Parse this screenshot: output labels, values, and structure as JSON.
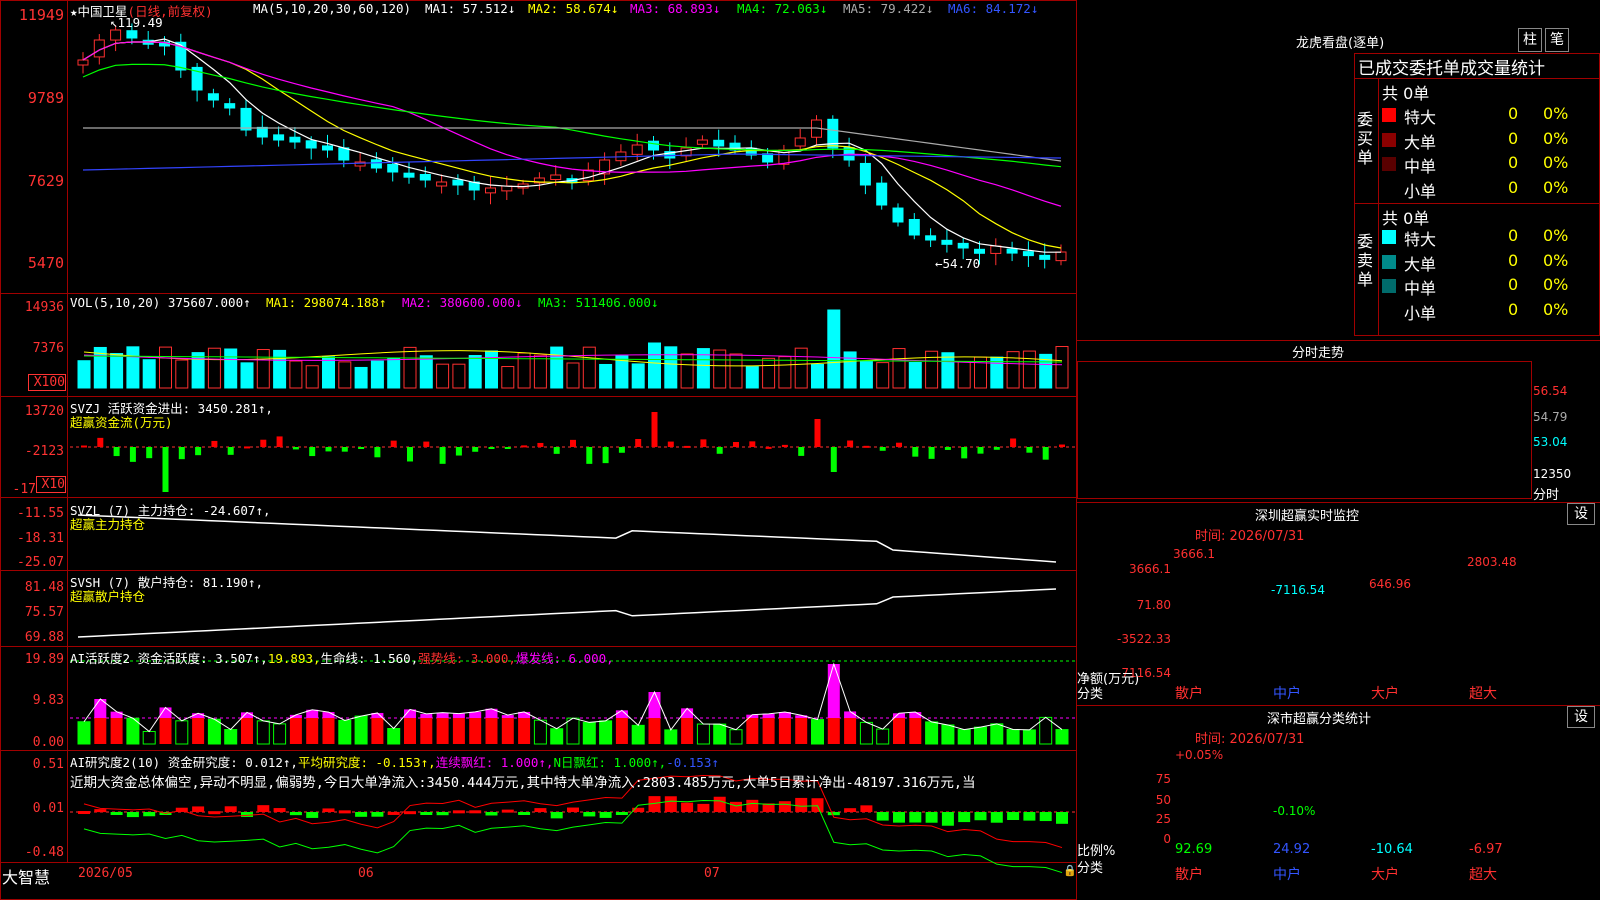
{
  "stock": {
    "name": "中国卫星",
    "period": "(日线,前复权)",
    "max_note": "119.49",
    "min_note": "←54.70"
  },
  "ma": {
    "params": "MA(5,10,20,30,60,120)",
    "ma1": "MA1: 57.512↓",
    "ma2": "MA2: 58.674↓",
    "ma3": "MA3: 68.893↓",
    "ma4": "MA4: 72.063↓",
    "ma5": "MA5: 79.422↓",
    "ma6": "MA6: 84.172↓"
  },
  "price_axis": [
    "11949",
    "9789",
    "7629",
    "5470"
  ],
  "vol": {
    "params": "VOL(5,10,20)",
    "value": "375607.000↑",
    "ma1": "MA1: 298074.188↑",
    "ma2": "MA2: 380600.000↓",
    "ma3": "MA3: 511406.000↓",
    "axis": [
      "14936",
      "7376"
    ],
    "unit": "X100"
  },
  "svzj": {
    "title": "SVZJ 活跃资金进出: 3450.281↑,",
    "subtitle": "超赢资金流(万元)",
    "axis": [
      "13720",
      "-2123",
      "-17"
    ],
    "unit": "X10"
  },
  "svzl": {
    "title": "SVZL (7) 主力持仓: -24.607↑,",
    "subtitle": "超赢主力持仓",
    "axis": [
      "-11.55",
      "-18.31",
      "-25.07"
    ]
  },
  "svsh": {
    "title": "SVSH (7) 散户持仓: 81.190↑,",
    "subtitle": "超赢散户持仓",
    "axis": [
      "81.48",
      "75.57",
      "69.88"
    ]
  },
  "ai1": {
    "label": "AI活跃度2 资金活跃度: 3.507↑,",
    "v2": "19.893,",
    "life": "生命线: 1.560,",
    "strong": "强势线: 3.000,",
    "burst": "爆发线: 6.000,",
    "axis": [
      "19.89",
      "9.83",
      "0.00"
    ]
  },
  "ai2": {
    "label": "AI研究度2(10) 资金研究度: 0.012↑,",
    "avg": "平均研究度: -0.153↑,",
    "cont": "连续飘红: 1.000↑,",
    "nday": "N日飘红: 1.000↑,",
    "last": "-0.153↑",
    "comment": "近期大资金总体偏空,异动不明显,偏弱势,今日大单净流入:3450.444万元,其中特大单净流入:2803.485万元,大单5日累计净出-48197.316万元,当",
    "axis": [
      "0.51",
      "0.01",
      "-0.48"
    ]
  },
  "dates": [
    "2026/05",
    "06",
    "07"
  ],
  "brand": "大智慧",
  "right": {
    "lhkp": {
      "title": "龙虎看盘(逐单)",
      "btn1": "柱",
      "btn2": "笔",
      "sub": "已成交委托单成交量统计",
      "buy": {
        "side": "委买单",
        "total": "共 0单",
        "rows": [
          {
            "label": "特大",
            "v": "0",
            "p": "0%",
            "color": "#ff0000"
          },
          {
            "label": "大单",
            "v": "0",
            "p": "0%",
            "color": "#8b0000"
          },
          {
            "label": "中单",
            "v": "0",
            "p": "0%",
            "color": "#5a0000"
          },
          {
            "label": "小单",
            "v": "0",
            "p": "0%",
            "color": ""
          }
        ]
      },
      "sell": {
        "side": "委卖单",
        "total": "共 0单",
        "rows": [
          {
            "label": "特大",
            "v": "0",
            "p": "0%",
            "color": "#00ffff"
          },
          {
            "label": "大单",
            "v": "0",
            "p": "0%",
            "color": "#008b8b"
          },
          {
            "label": "中单",
            "v": "0",
            "p": "0%",
            "color": "#006b6b"
          },
          {
            "label": "小单",
            "v": "0",
            "p": "0%",
            "color": ""
          }
        ]
      }
    },
    "fenshi": {
      "title": "分时走势",
      "axis": [
        "56.54",
        "54.79",
        "53.04",
        "12350"
      ],
      "unit": "分时"
    },
    "sz": {
      "title": "深圳超赢实时监控",
      "btn": "设",
      "time": "时间: 2026/07/31",
      "axis": [
        "3666.1",
        "71.80",
        "-3522.33",
        "-7116.54"
      ],
      "ylabel": "净额(万元)",
      "xlabel": "分类",
      "cats": [
        "散户",
        "中户",
        "大户",
        "超大"
      ],
      "labels": [
        "3666.1",
        "-7116.54",
        "646.96",
        "2803.48"
      ],
      "values": [
        3666.1,
        -7116.54,
        646.96,
        2803.48
      ]
    },
    "sh": {
      "title": "深市超赢分类统计",
      "btn": "设",
      "time": "时间: 2026/07/31",
      "axis": [
        "75",
        "50",
        "25",
        "0"
      ],
      "ylabel": "比例%",
      "xlabel": "分类",
      "cats": [
        "散户",
        "中户",
        "大户",
        "超大"
      ],
      "top": [
        "+0.05%",
        "-0.10%"
      ],
      "bottom": [
        "92.69",
        "24.92",
        "-10.64",
        "-6.97"
      ],
      "values": [
        92.69,
        24.92,
        -10.64,
        -6.97
      ]
    }
  }
}
